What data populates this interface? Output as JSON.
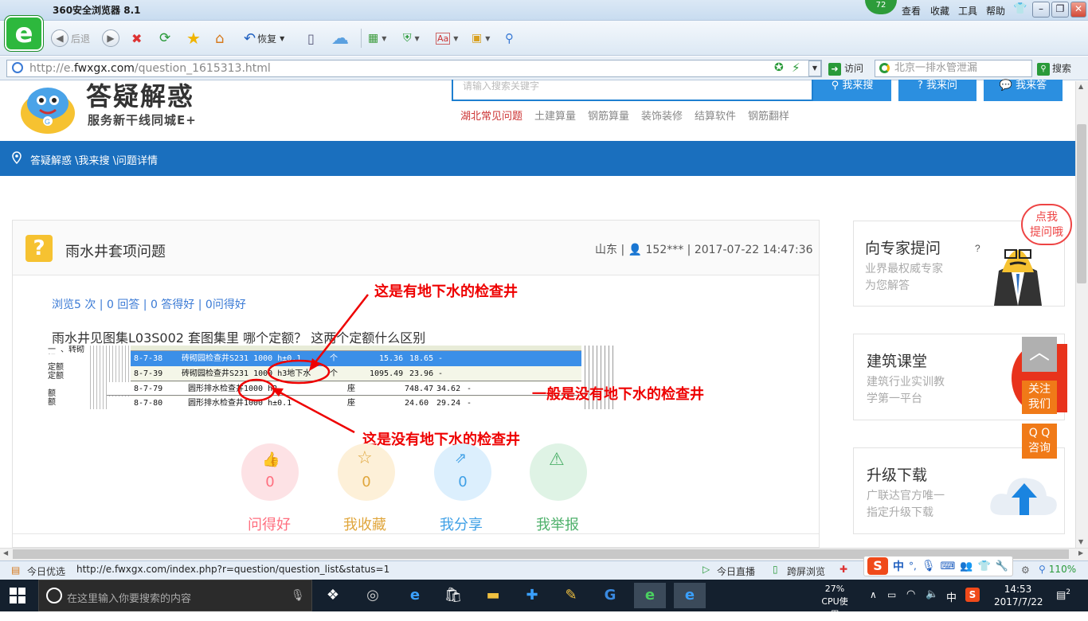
{
  "browser": {
    "title": "360安全浏览器 8.1",
    "badge": "72",
    "menu": [
      "查看",
      "收藏",
      "工具",
      "帮助"
    ],
    "toolbar": {
      "back": "后退",
      "restore": "恢复"
    },
    "address": {
      "prefix": "http://e.",
      "domain": "fwxgx.com",
      "path": "/question_1615313.html"
    },
    "visit_label": "访问",
    "search_placeholder": "北京一排水管泄漏",
    "search_label": "搜索"
  },
  "site": {
    "logo_title": "答疑解惑",
    "logo_sub": "服务新干线同城E+",
    "search_placeholder": "请输入搜索关键字",
    "search_buttons": [
      "我来搜",
      "我来问",
      "我来答"
    ],
    "hotlinks": [
      "湖北常见问题",
      "土建算量",
      "钢筋算量",
      "装饰装修",
      "结算软件",
      "钢筋翻样"
    ],
    "breadcrumb": "答疑解惑 \\我来搜 \\问题详情"
  },
  "question": {
    "title": "雨水井套项问题",
    "meta": "山东 | 👤 152*** | 2017-07-22 14:47:36",
    "stats": "浏览5 次 | 0 回答 | 0 答得好 | 0问得好",
    "body": "雨水井见图集L03S002  套图集里   哪个定额？ 这两个定额什么区别"
  },
  "screenshot_table": {
    "left_labels": [
      "一 、转砌钢",
      "定额",
      "定额",
      "额",
      "额"
    ],
    "rows": [
      {
        "code": "8-7-38",
        "name": "砖砌园检查井S231 1000 h±0.1",
        "unit": "个",
        "qty": "15.36",
        "val": "18.65",
        "extra": "-"
      },
      {
        "code": "8-7-39",
        "name": "砖砌园检查井S231 1000 h3地下水",
        "unit": "个",
        "qty": "1095.49",
        "val": "23.96",
        "extra": "-"
      },
      {
        "code": "8-7-79",
        "name": "圆形排水检查井1000 h2",
        "unit": "座",
        "qty": "748.47",
        "val": "34.62",
        "extra": "-"
      },
      {
        "code": "8-7-80",
        "name": "圆形排水检查井1000 h±0.1",
        "unit": "座",
        "qty": "24.60",
        "val": "29.24",
        "extra": "-"
      }
    ]
  },
  "annotations": {
    "top": "这是有地下水的检查井",
    "right": "一般是没有地下水的检查井",
    "bottom": "这是没有地下水的检查井"
  },
  "actions": [
    {
      "label": "问得好",
      "count": "0",
      "color": "#ff6f7f"
    },
    {
      "label": "我收藏",
      "count": "0",
      "color": "#e0a63c"
    },
    {
      "label": "我分享",
      "count": "0",
      "color": "#3fa0e6"
    },
    {
      "label": "我举报",
      "count": "0",
      "color": "#4db06a"
    }
  ],
  "sidebar": {
    "expert": {
      "title": "向专家提问",
      "sub1": "业界最权威专家",
      "sub2": "为您解答",
      "bubble1": "点我",
      "bubble2": "提问哦"
    },
    "class": {
      "title": "建筑课堂",
      "sub1": "建筑行业实训教",
      "sub2": "学第一平台"
    },
    "upgrade": {
      "title": "升级下载",
      "sub1": "广联达官方唯一",
      "sub2": "指定升级下载"
    },
    "follow": [
      "关注",
      "我们"
    ],
    "qq": [
      "Q Q",
      "咨询"
    ]
  },
  "statusbar": {
    "left": "今日优选",
    "url": "http://e.fwxgx.com/index.php?r=question/question_list&status=1",
    "live": "今日直播",
    "cross": "跨屏浏览",
    "zoom": "110%",
    "ime": "中"
  },
  "taskbar": {
    "search_placeholder": "在这里输入你要搜索的内容",
    "cpu_pct": "27%",
    "cpu_label": "CPU使用",
    "ime": "中",
    "time": "14:53",
    "date": "2017/7/22",
    "notifications": "2"
  }
}
